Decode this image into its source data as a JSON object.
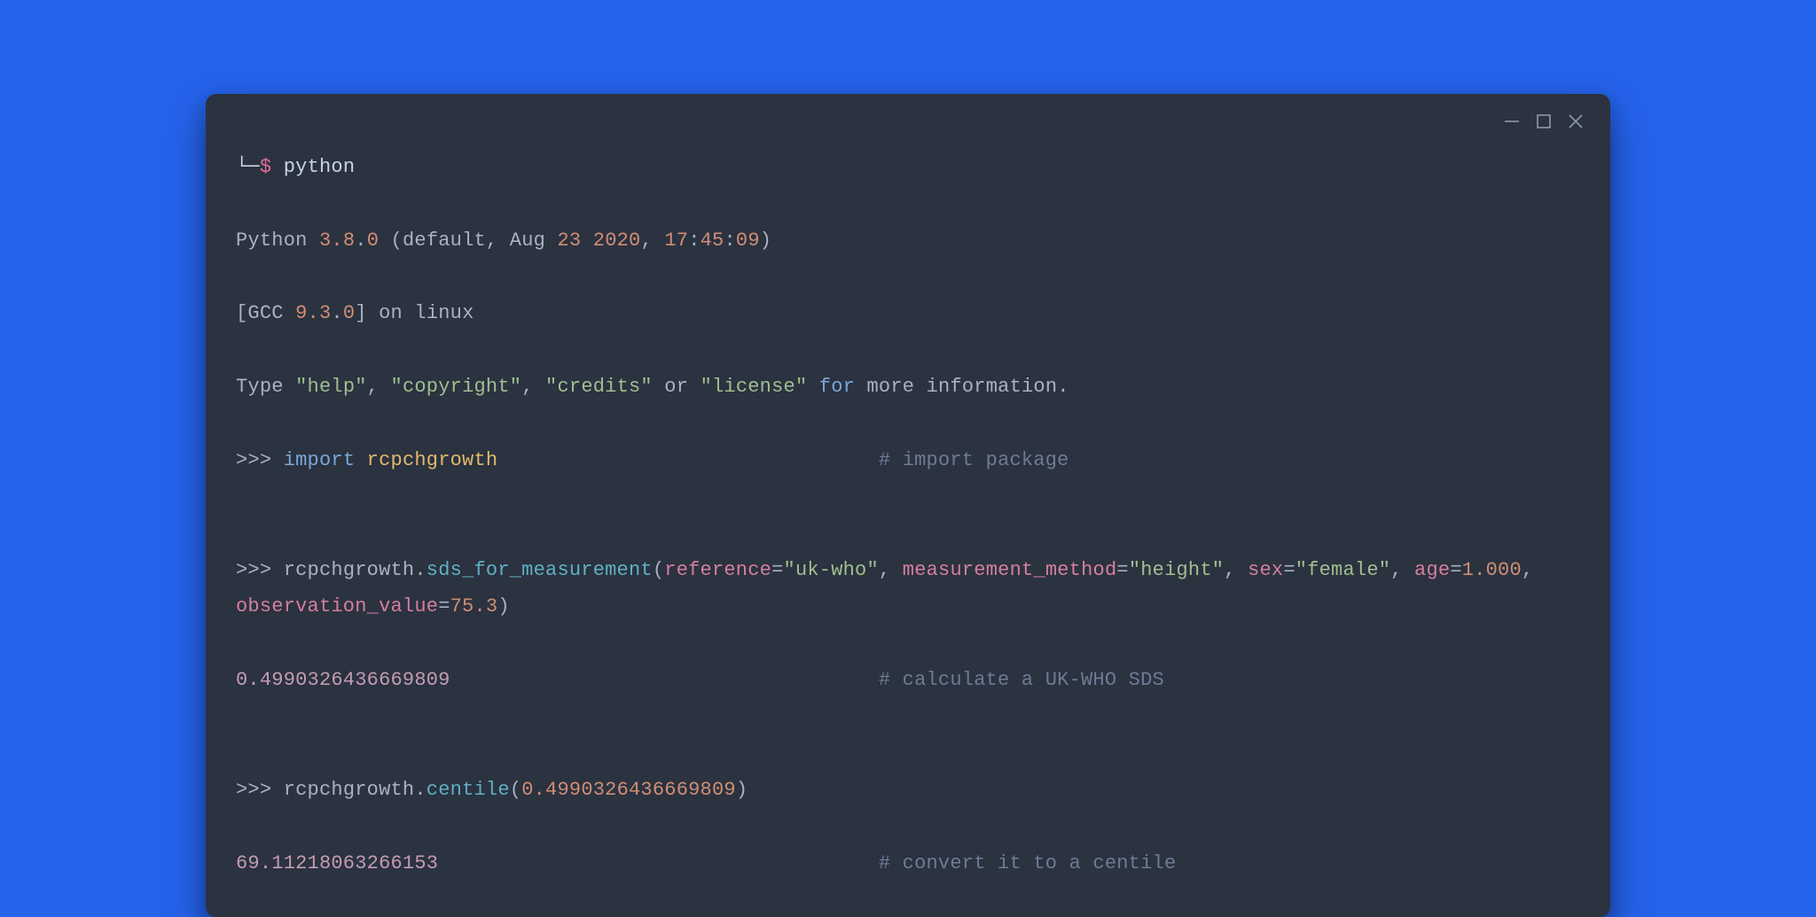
{
  "shell": {
    "corner": "└─",
    "dollar": "$",
    "cmd": "python"
  },
  "banner": {
    "l1a": "Python ",
    "l1b": "3.8",
    "l1c": ".",
    "l1d": "0",
    "l1e": " (default, Aug ",
    "l1f": "23",
    "l1g": " ",
    "l1h": "2020",
    "l1i": ", ",
    "l1j": "17",
    "l1k": ":",
    "l1l": "45",
    "l1m": ":",
    "l1n": "09",
    "l1o": ")",
    "l2a": "[GCC ",
    "l2b": "9.3",
    "l2c": ".",
    "l2d": "0",
    "l2e": "] on linux",
    "l3a": "Type ",
    "l3b": "\"help\"",
    "l3c": ", ",
    "l3d": "\"copyright\"",
    "l3e": ", ",
    "l3f": "\"credits\"",
    "l3g": " or ",
    "l3h": "\"license\"",
    "l3i": " for",
    "l3j": " more information."
  },
  "repl": {
    "p": ">>> ",
    "importKw": "import",
    "importPkg": " rcpchgrowth",
    "importPad": "                                ",
    "importComment": "# import package",
    "call1_obj": "rcpchgrowth",
    "call1_dot": ".",
    "call1_fn": "sds_for_measurement",
    "call1_open": "(",
    "call1_arg1": "reference",
    "call1_eq": "=",
    "call1_val1": "\"uk-who\"",
    "call1_comma": ", ",
    "call1_arg2": "measurement_method",
    "call1_val2": "\"height\"",
    "call1_cont_arg3": "sex",
    "call1_cont_val3": "\"female\"",
    "call1_cont_arg4": "age",
    "call1_cont_val4": "1.000",
    "call1_cont_arg5": "observation_value",
    "call1_cont_val5": "75.3",
    "call1_close": ")",
    "result1": "0.4990326436669809",
    "result1_pad": "                                    ",
    "result1_comment": "# calculate a UK-WHO SDS",
    "call2_obj": "rcpchgrowth",
    "call2_fn": "centile",
    "call2_open": "(",
    "call2_arg": "0.4990326436669809",
    "call2_close": ")",
    "result2": "69.11218063266153",
    "result2_pad": "                                     ",
    "result2_comment": "# convert it to a centile"
  }
}
